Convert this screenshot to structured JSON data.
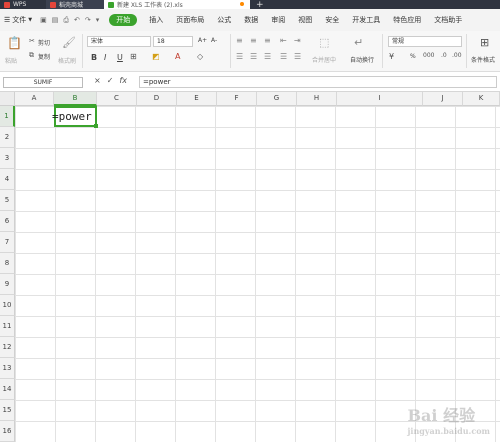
{
  "titlebar": {
    "tabs": [
      {
        "label": "WPS"
      },
      {
        "label": "稻壳商城"
      },
      {
        "label": "新建 XLS 工作表 (2).xls"
      }
    ],
    "new_tab_symbol": "+",
    "colors": {
      "bg": "#2f3440",
      "wps": "#e5463b",
      "store": "#e5463b",
      "doc": "#3ba32d",
      "unsaved_dot": "#ff8a00"
    }
  },
  "menubar": {
    "file_label": "文件",
    "active_tab": "开始",
    "tabs": [
      "插入",
      "页面布局",
      "公式",
      "数据",
      "审阅",
      "视图",
      "安全",
      "开发工具",
      "特色应用",
      "文档助手"
    ],
    "accent": "#3ba32d"
  },
  "ribbon": {
    "paste_label": "粘贴",
    "cut_label": "剪切",
    "copy_label": "复制",
    "format_painter_label": "格式刷",
    "font_name": "宋体",
    "font_size": "18",
    "bold": "B",
    "italic": "I",
    "underline": "U",
    "grow_font": "A+",
    "shrink_font": "A-",
    "merge_center_label": "合并居中",
    "wrap_text_label": "自动换行",
    "number_format": "常规",
    "percent": "%",
    "conditional_format_label": "条件格式"
  },
  "formulabar": {
    "name_box": "SUMIF",
    "cancel_symbol": "×",
    "confirm_symbol": "✓",
    "fx_label": "fx",
    "formula": "=power"
  },
  "grid": {
    "columns": [
      "A",
      "B",
      "C",
      "D",
      "E",
      "F",
      "G",
      "H",
      "I",
      "J",
      "K"
    ],
    "rows": [
      "1",
      "2",
      "3",
      "4",
      "5",
      "6",
      "7",
      "8",
      "9",
      "10",
      "11",
      "12",
      "13",
      "14",
      "15",
      "16"
    ],
    "selected_column": "B",
    "selected_row": "1",
    "active_cell_text": "=power"
  },
  "watermark": {
    "text": "Bai 经验",
    "sub": "jingyan.baidu.com"
  }
}
